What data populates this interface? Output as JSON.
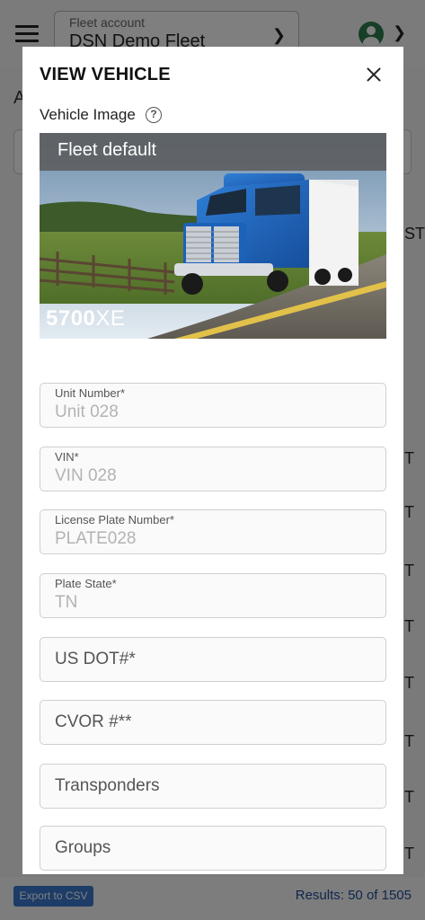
{
  "header": {
    "fleet_account_label": "Fleet account",
    "fleet_account_value": "DSN Demo Fleet"
  },
  "background": {
    "partial_letter": "A",
    "right_edge_chars": [
      "ST",
      "T",
      "T",
      "T",
      "T",
      "T",
      "T",
      "T",
      "T",
      "T",
      "T"
    ]
  },
  "footer": {
    "export_label": "Export to CSV",
    "results_text": "Results: 50 of 1505"
  },
  "modal": {
    "title": "VIEW VEHICLE",
    "vehicle_image_label": "Vehicle Image",
    "help_glyph": "?",
    "image_banner": "Fleet default",
    "image_model_bold": "5700",
    "image_model_light": "XE",
    "fields": [
      {
        "label": "Unit Number*",
        "value": "Unit 028"
      },
      {
        "label": "VIN*",
        "value": "VIN 028"
      },
      {
        "label": "License Plate Number*",
        "value": "PLATE028"
      },
      {
        "label": "Plate State*",
        "value": "TN"
      }
    ],
    "empty_fields": [
      {
        "placeholder": "US DOT#*"
      },
      {
        "placeholder": "CVOR #**"
      },
      {
        "placeholder": "Transponders"
      },
      {
        "placeholder": "Groups"
      }
    ]
  },
  "colors": {
    "accent": "#3b7bd0",
    "avatar": "#2e7d4f",
    "link_text": "#1e4f9a"
  }
}
